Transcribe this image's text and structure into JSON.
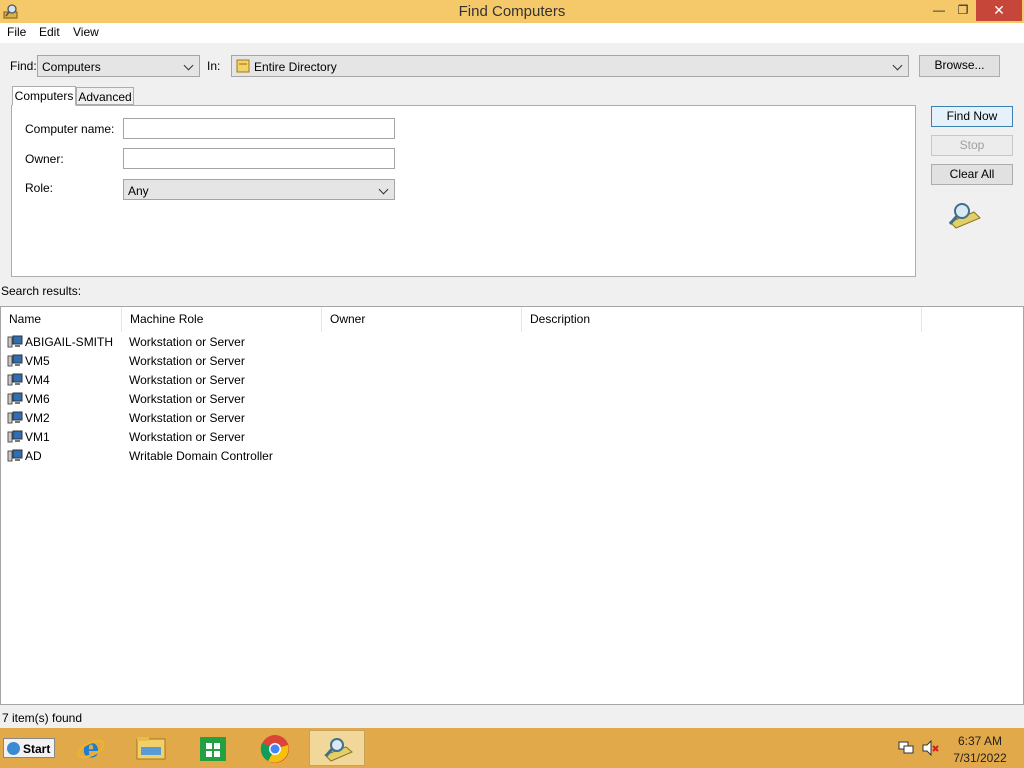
{
  "window": {
    "title": "Find Computers",
    "min_glyph": "—",
    "max_glyph": "❐",
    "close_glyph": "✕"
  },
  "menu": {
    "items": [
      "File",
      "Edit",
      "View"
    ]
  },
  "find_row": {
    "find_label": "Find:",
    "find_value": "Computers",
    "in_label": "In:",
    "in_value": "Entire Directory",
    "browse_label": "Browse..."
  },
  "tabs": [
    "Computers",
    "Advanced"
  ],
  "form": {
    "computer_name_label": "Computer name:",
    "computer_name_value": "",
    "owner_label": "Owner:",
    "owner_value": "",
    "role_label": "Role:",
    "role_value": "Any"
  },
  "actions": {
    "find_now": "Find Now",
    "stop": "Stop",
    "clear_all": "Clear All"
  },
  "results": {
    "label": "Search results:",
    "columns": [
      "Name",
      "Machine Role",
      "Owner",
      "Description"
    ],
    "rows": [
      {
        "name": "ABIGAIL-SMITH",
        "role": "Workstation or Server"
      },
      {
        "name": "VM5",
        "role": "Workstation or Server"
      },
      {
        "name": "VM4",
        "role": "Workstation or Server"
      },
      {
        "name": "VM6",
        "role": "Workstation or Server"
      },
      {
        "name": "VM2",
        "role": "Workstation or Server"
      },
      {
        "name": "VM1",
        "role": "Workstation or Server"
      },
      {
        "name": "AD",
        "role": "Writable Domain Controller"
      }
    ]
  },
  "status": {
    "text": "7 item(s) found"
  },
  "taskbar": {
    "start_label": "Start",
    "time": "6:37 AM",
    "date": "7/31/2022",
    "apps": [
      "internet-explorer",
      "file-explorer",
      "store",
      "chrome",
      "find-computers"
    ]
  },
  "colors": {
    "titlebar": "#f5c96a",
    "taskbar": "#e2a94a",
    "close": "#c7463a"
  }
}
